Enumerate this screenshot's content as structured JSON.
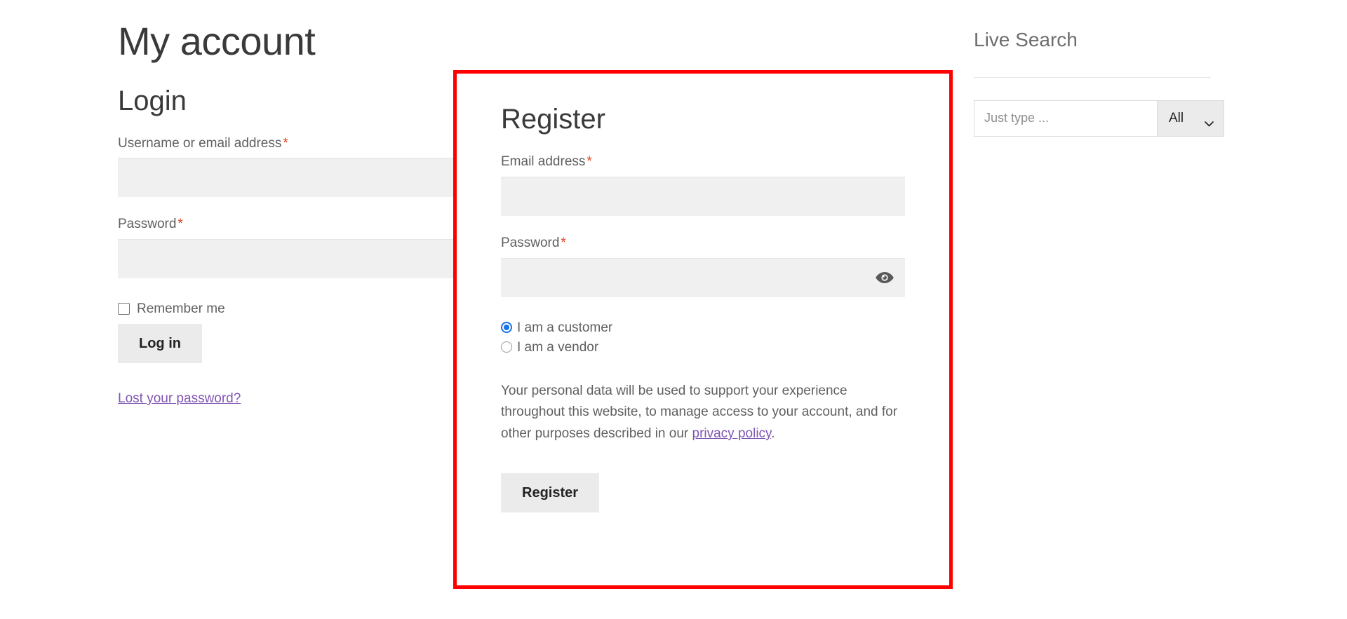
{
  "page": {
    "title": "My account"
  },
  "login": {
    "heading": "Login",
    "username": {
      "label": "Username or email address",
      "required_mark": "*",
      "value": "",
      "placeholder": ""
    },
    "password": {
      "label": "Password",
      "required_mark": "*",
      "value": "",
      "placeholder": "",
      "toggle_icon": "eye-icon"
    },
    "remember_label": "Remember me",
    "remember_checked": false,
    "submit_label": "Log in",
    "lost_password_label": "Lost your password?"
  },
  "register": {
    "heading": "Register",
    "highlight_color": "#ff0000",
    "email": {
      "label": "Email address",
      "required_mark": "*",
      "value": "",
      "placeholder": ""
    },
    "password": {
      "label": "Password",
      "required_mark": "*",
      "value": "",
      "placeholder": "",
      "toggle_icon": "eye-icon"
    },
    "account_type": {
      "customer_label": "I am a customer",
      "vendor_label": "I am a vendor",
      "selected": "customer"
    },
    "privacy_text_before": "Your personal data will be used to support your experience throughout this website, to manage access to your account, and for other purposes described in our ",
    "privacy_link_label": "privacy policy",
    "privacy_text_after": ".",
    "submit_label": "Register"
  },
  "sidebar": {
    "widget_title": "Live Search",
    "search": {
      "placeholder": "Just type ...",
      "value": "",
      "category_selected": "All",
      "dropdown_icon": "chevron-down-icon"
    }
  },
  "colors": {
    "accent_link": "#7f54b3",
    "required_asterisk": "#e2401c",
    "radio_selected": "#1a73e8",
    "input_background": "#f0f0f0",
    "button_background": "#ebebeb",
    "highlight_border": "#ff0000"
  }
}
